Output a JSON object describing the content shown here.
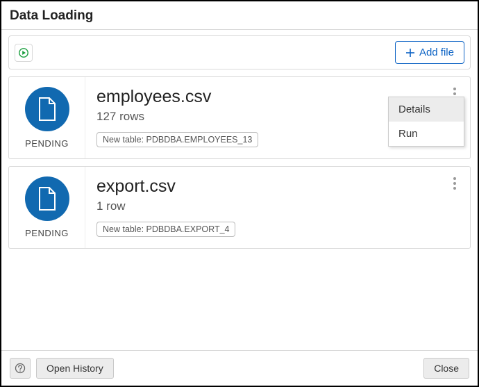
{
  "header": {
    "title": "Data Loading"
  },
  "toolbar": {
    "add_file_label": "Add file"
  },
  "files": [
    {
      "status": "PENDING",
      "filename": "employees.csv",
      "rowcount": "127 rows",
      "table_tag": "New table: PDBDBA.EMPLOYEES_13",
      "menu_open": true
    },
    {
      "status": "PENDING",
      "filename": "export.csv",
      "rowcount": "1 row",
      "table_tag": "New table: PDBDBA.EXPORT_4",
      "menu_open": false
    }
  ],
  "menu": {
    "details": "Details",
    "run": "Run"
  },
  "footer": {
    "open_history": "Open History",
    "close": "Close"
  }
}
